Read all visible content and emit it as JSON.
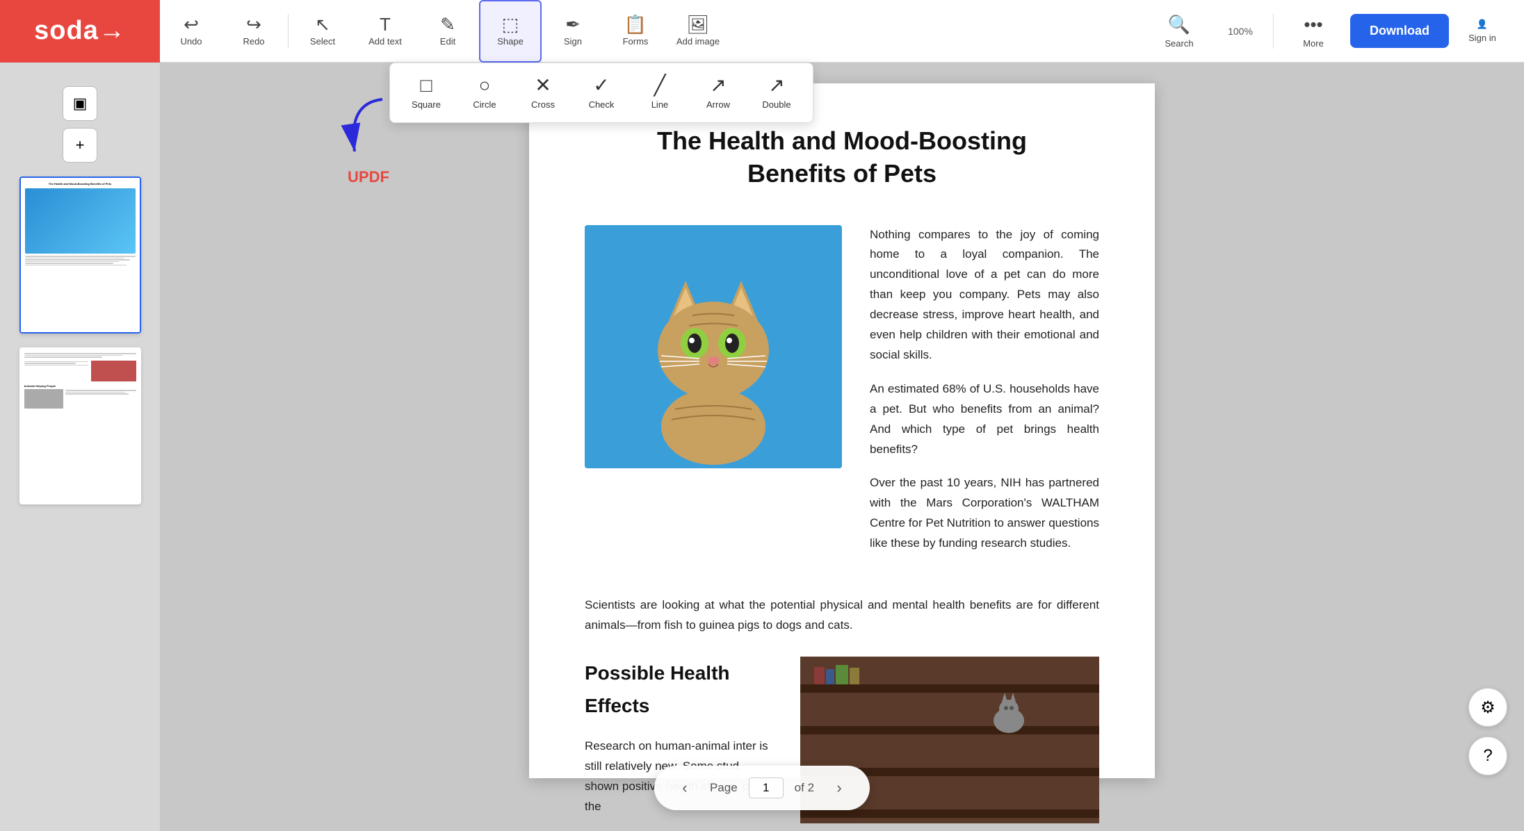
{
  "app": {
    "name": "soda→",
    "logo_bg": "#e8473f"
  },
  "toolbar": {
    "undo_label": "Undo",
    "redo_label": "Redo",
    "select_label": "Select",
    "add_text_label": "Add text",
    "edit_label": "Edit",
    "shape_label": "Shape",
    "sign_label": "Sign",
    "forms_label": "Forms",
    "add_image_label": "Add image",
    "search_label": "Search",
    "zoom_value": "100%",
    "more_label": "More",
    "download_label": "Download",
    "signin_label": "Sign in"
  },
  "shape_toolbar": {
    "square_label": "Square",
    "circle_label": "Circle",
    "cross_label": "Cross",
    "check_label": "Check",
    "line_label": "Line",
    "arrow_label": "Arrow",
    "double_label": "Double"
  },
  "updf_tooltip": "UPDF",
  "pdf": {
    "title": "The Health and Mood-Boosting\nBenefits of Pets",
    "para1": "Nothing compares to the joy of coming home to a loyal companion. The unconditional love of a pet can do more than keep you company. Pets may also decrease stress, improve heart health, and even help children  with  their emotional and social skills.",
    "para2": "An estimated 68% of U.S. households have a pet. But who benefits from an animal? And which type of pet brings health benefits?",
    "para3": "Over the past 10 years, NIH has partnered with the Mars Corporation's WALTHAM Centre for Pet Nutrition to answer questions like these by funding research studies.",
    "scientists_text": "Scientists are looking at what the potential physical and mental health benefits are for different animals—from fish to guinea pigs to dogs and cats.",
    "health_effects_title": "Possible Health Effects",
    "health_effects_text": "Research on human-animal inter   is still relatively new. Some stud   shown positive health effects, but the"
  },
  "page_nav": {
    "page_label": "Page",
    "current_page": "1",
    "total_pages": "of 2"
  },
  "sidebar": {
    "panel_icon": "▣",
    "add_icon": "+"
  }
}
